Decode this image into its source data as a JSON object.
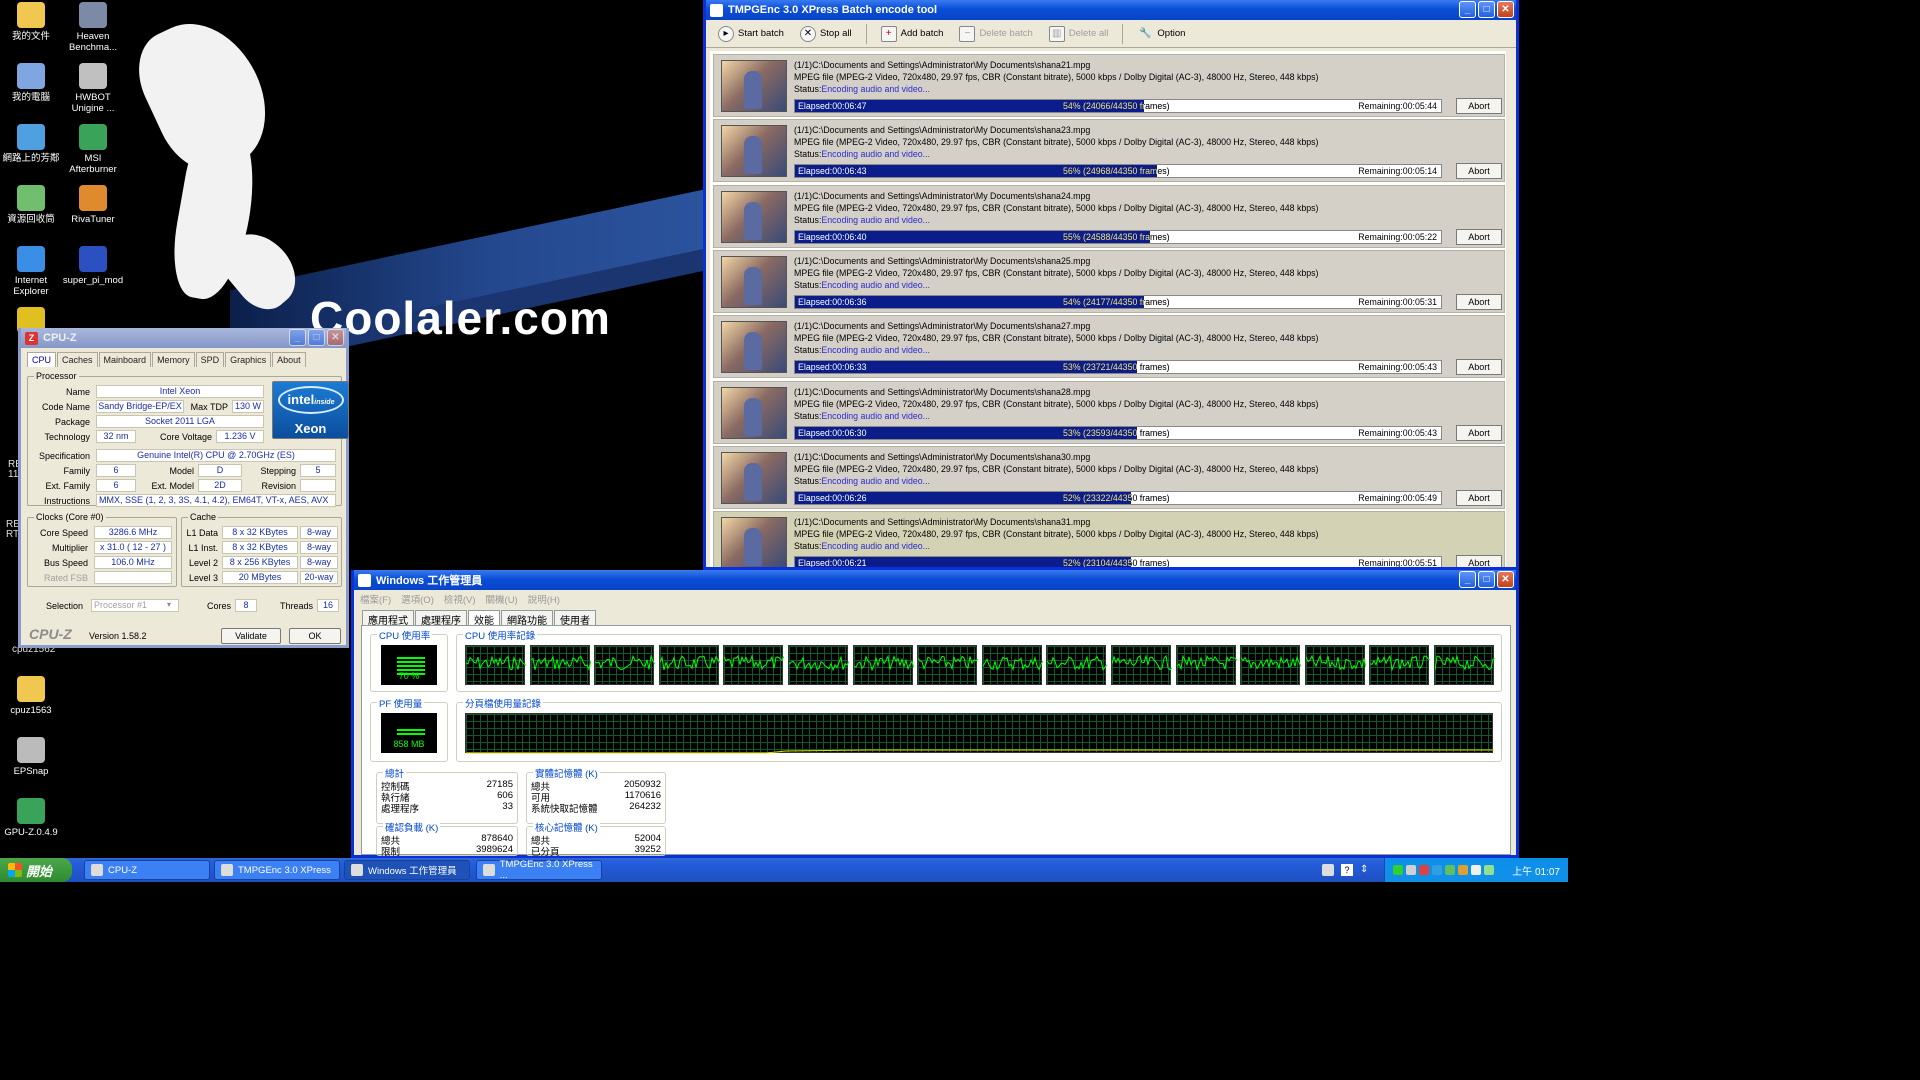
{
  "desktop": {
    "wallpaper_text": "Coolaler.com",
    "icons": [
      {
        "label": "我的文件",
        "icon": "documents-folder-icon",
        "color": "#f0c850"
      },
      {
        "label": "Heaven Benchma...",
        "icon": "heaven-benchmark-icon",
        "color": "#7c8aa6"
      },
      {
        "label": "我的電腦",
        "icon": "my-computer-icon",
        "color": "#7fa6e0"
      },
      {
        "label": "HWBOT Unigine ...",
        "icon": "hwbot-icon",
        "color": "#c0c0c0"
      },
      {
        "label": "網路上的芳鄰",
        "icon": "network-icon",
        "color": "#4fa0e0"
      },
      {
        "label": "MSI Afterburner",
        "icon": "afterburner-icon",
        "color": "#3aa35a"
      },
      {
        "label": "資源回收筒",
        "icon": "recycle-bin-icon",
        "color": "#6fbf6f"
      },
      {
        "label": "RivaTuner",
        "icon": "rivatuner-icon",
        "color": "#e08a30"
      },
      {
        "label": "Internet Explorer",
        "icon": "internet-explorer-icon",
        "color": "#3a8ee6"
      },
      {
        "label": "super_pi_mod",
        "icon": "super-pi-icon",
        "color": "#2c4fc2"
      },
      {
        "label": "3DM",
        "icon": "3dmark-icon",
        "color": "#e0c020"
      },
      {
        "label": "cpuz1563",
        "icon": "folder-icon",
        "color": "#f0c850"
      },
      {
        "label": "EPSnap",
        "icon": "camera-icon",
        "color": "#bbbbbb"
      },
      {
        "label": "GPU-Z.0.4.9",
        "icon": "gpuz-icon",
        "color": "#3aa35a"
      }
    ],
    "edge_texts": [
      "RE 11",
      "RE RT",
      "cpuz1562"
    ]
  },
  "tmpgenc": {
    "title": "TMPGEnc 3.0 XPress Batch encode tool",
    "toolbar": {
      "start_batch": "Start batch",
      "stop_all": "Stop all",
      "add_batch": "Add batch",
      "delete_batch": "Delete batch",
      "delete_all": "Delete all",
      "option": "Option"
    },
    "status_label": "Status:",
    "abort_label": "Abort",
    "jobs": [
      {
        "path": "(1/1)C:\\Documents and Settings\\Administrator\\My Documents\\shana21.mpg",
        "info": "MPEG file (MPEG-2 Video, 720x480, 29.97 fps, CBR (Constant bitrate), 5000 kbps / Dolby Digital (AC-3), 48000 Hz, Stereo, 448 kbps)",
        "status": "Encoding audio and video...",
        "elapsed": "Elapsed:00:06:47",
        "progress_text": "54% (24066/44350 frames)",
        "progress": 0.54,
        "remaining": "Remaining:00:05:44"
      },
      {
        "path": "(1/1)C:\\Documents and Settings\\Administrator\\My Documents\\shana23.mpg",
        "info": "MPEG file (MPEG-2 Video, 720x480, 29.97 fps, CBR (Constant bitrate), 5000 kbps / Dolby Digital (AC-3), 48000 Hz, Stereo, 448 kbps)",
        "status": "Encoding audio and video...",
        "elapsed": "Elapsed:00:06:43",
        "progress_text": "56% (24968/44350 frames)",
        "progress": 0.56,
        "remaining": "Remaining:00:05:14"
      },
      {
        "path": "(1/1)C:\\Documents and Settings\\Administrator\\My Documents\\shana24.mpg",
        "info": "MPEG file (MPEG-2 Video, 720x480, 29.97 fps, CBR (Constant bitrate), 5000 kbps / Dolby Digital (AC-3), 48000 Hz, Stereo, 448 kbps)",
        "status": "Encoding audio and video...",
        "elapsed": "Elapsed:00:06:40",
        "progress_text": "55% (24588/44350 frames)",
        "progress": 0.55,
        "remaining": "Remaining:00:05:22"
      },
      {
        "path": "(1/1)C:\\Documents and Settings\\Administrator\\My Documents\\shana25.mpg",
        "info": "MPEG file (MPEG-2 Video, 720x480, 29.97 fps, CBR (Constant bitrate), 5000 kbps / Dolby Digital (AC-3), 48000 Hz, Stereo, 448 kbps)",
        "status": "Encoding audio and video...",
        "elapsed": "Elapsed:00:06:36",
        "progress_text": "54% (24177/44350 frames)",
        "progress": 0.54,
        "remaining": "Remaining:00:05:31"
      },
      {
        "path": "(1/1)C:\\Documents and Settings\\Administrator\\My Documents\\shana27.mpg",
        "info": "MPEG file (MPEG-2 Video, 720x480, 29.97 fps, CBR (Constant bitrate), 5000 kbps / Dolby Digital (AC-3), 48000 Hz, Stereo, 448 kbps)",
        "status": "Encoding audio and video...",
        "elapsed": "Elapsed:00:06:33",
        "progress_text": "53% (23721/44350 frames)",
        "progress": 0.53,
        "remaining": "Remaining:00:05:43"
      },
      {
        "path": "(1/1)C:\\Documents and Settings\\Administrator\\My Documents\\shana28.mpg",
        "info": "MPEG file (MPEG-2 Video, 720x480, 29.97 fps, CBR (Constant bitrate), 5000 kbps / Dolby Digital (AC-3), 48000 Hz, Stereo, 448 kbps)",
        "status": "Encoding audio and video...",
        "elapsed": "Elapsed:00:06:30",
        "progress_text": "53% (23593/44350 frames)",
        "progress": 0.53,
        "remaining": "Remaining:00:05:43"
      },
      {
        "path": "(1/1)C:\\Documents and Settings\\Administrator\\My Documents\\shana30.mpg",
        "info": "MPEG file (MPEG-2 Video, 720x480, 29.97 fps, CBR (Constant bitrate), 5000 kbps / Dolby Digital (AC-3), 48000 Hz, Stereo, 448 kbps)",
        "status": "Encoding audio and video...",
        "elapsed": "Elapsed:00:06:26",
        "progress_text": "52% (23322/44350 frames)",
        "progress": 0.52,
        "remaining": "Remaining:00:05:49"
      },
      {
        "path": "(1/1)C:\\Documents and Settings\\Administrator\\My Documents\\shana31.mpg",
        "info": "MPEG file (MPEG-2 Video, 720x480, 29.97 fps, CBR (Constant bitrate), 5000 kbps / Dolby Digital (AC-3), 48000 Hz, Stereo, 448 kbps)",
        "status": "Encoding audio and video...",
        "elapsed": "Elapsed:00:06:21",
        "progress_text": "52% (23104/44350 frames)",
        "progress": 0.52,
        "remaining": "Remaining:00:05:51"
      }
    ]
  },
  "cpuz": {
    "title": "CPU-Z",
    "tabs": [
      "CPU",
      "Caches",
      "Mainboard",
      "Memory",
      "SPD",
      "Graphics",
      "About"
    ],
    "processor_group": "Processor",
    "labels": {
      "name": "Name",
      "code_name": "Code Name",
      "max_tdp": "Max TDP",
      "package": "Package",
      "technology": "Technology",
      "core_voltage": "Core Voltage",
      "specification": "Specification",
      "family": "Family",
      "model": "Model",
      "stepping": "Stepping",
      "ext_family": "Ext. Family",
      "ext_model": "Ext. Model",
      "revision": "Revision",
      "instructions": "Instructions",
      "core_speed": "Core Speed",
      "multiplier": "Multiplier",
      "bus_speed": "Bus Speed",
      "rated_fsb": "Rated FSB",
      "l1_data": "L1 Data",
      "l1_inst": "L1 Inst.",
      "level2": "Level 2",
      "level3": "Level 3",
      "selection": "Selection",
      "cores": "Cores",
      "threads": "Threads"
    },
    "values": {
      "name": "Intel Xeon",
      "code_name": "Sandy Bridge-EP/EX",
      "max_tdp": "130 W",
      "package": "Socket 2011 LGA",
      "technology": "32 nm",
      "core_voltage": "1.236 V",
      "specification": "Genuine Intel(R) CPU  @ 2.70GHz (ES)",
      "family": "6",
      "model": "D",
      "stepping": "5",
      "ext_family": "6",
      "ext_model": "2D",
      "revision": "",
      "instructions": "MMX, SSE (1, 2, 3, 3S, 4.1, 4.2), EM64T, VT-x, AES, AVX",
      "core_speed": "3286.6 MHz",
      "multiplier": "x 31.0 ( 12 - 27 )",
      "bus_speed": "106.0 MHz",
      "rated_fsb": "",
      "l1_data": "8 x 32 KBytes",
      "l1_data_way": "8-way",
      "l1_inst": "8 x 32 KBytes",
      "l1_inst_way": "8-way",
      "level2": "8 x 256 KBytes",
      "level2_way": "8-way",
      "level3": "20 MBytes",
      "level3_way": "20-way",
      "selection": "Processor #1",
      "cores": "8",
      "threads": "16"
    },
    "clocks_group": "Clocks (Core #0)",
    "cache_group": "Cache",
    "badge_top": "intel",
    "badge_inside": "inside",
    "badge_bottom": "Xeon",
    "brand": "CPU-Z",
    "version": "Version 1.58.2",
    "validate_label": "Validate",
    "ok_label": "OK"
  },
  "taskmgr": {
    "title": "Windows 工作管理員",
    "menu": [
      "檔案(F)",
      "選項(O)",
      "檢視(V)",
      "關機(U)",
      "說明(H)"
    ],
    "tabs": [
      "應用程式",
      "處理程序",
      "效能",
      "網路功能",
      "使用者"
    ],
    "active_tab": 2,
    "cpu_usage_label": "CPU 使用率",
    "cpu_usage_value": "70 %",
    "cpu_usage": 0.7,
    "cpu_history_label": "CPU 使用率記錄",
    "cpu_graph_count": 16,
    "pf_usage_label": "PF 使用量",
    "pf_usage_value": "858 MB",
    "pf_history_label": "分頁檔使用量記錄",
    "totals": {
      "title": "總計",
      "rows": [
        [
          "控制碼",
          "27185"
        ],
        [
          "執行緒",
          "606"
        ],
        [
          "處理程序",
          "33"
        ]
      ]
    },
    "physical": {
      "title": "實體記憶體 (K)",
      "rows": [
        [
          "總共",
          "2050932"
        ],
        [
          "可用",
          "1170616"
        ],
        [
          "系統快取記憶體",
          "264232"
        ]
      ]
    },
    "commit": {
      "title": "確認負載 (K)",
      "rows": [
        [
          "總共",
          "878640"
        ],
        [
          "限制",
          "3989624"
        ]
      ]
    },
    "kernel": {
      "title": "核心記憶體 (K)",
      "rows": [
        [
          "總共",
          "52004"
        ],
        [
          "已分頁",
          "39252"
        ]
      ]
    }
  },
  "taskbar": {
    "start": "開始",
    "items": [
      {
        "label": "CPU-Z",
        "active": false
      },
      {
        "label": "TMPGEnc 3.0 XPress",
        "active": false
      },
      {
        "label": "Windows 工作管理員",
        "active": true
      },
      {
        "label": "TMPGEnc 3.0 XPress ...",
        "active": false
      }
    ],
    "clock": "上午 01:07"
  },
  "colors": {
    "xp_blue": "#0a4fd6",
    "progress_fill": "#0a1d8a",
    "graph_green": "#00ff00",
    "status_blue": "#2b2bd0"
  }
}
